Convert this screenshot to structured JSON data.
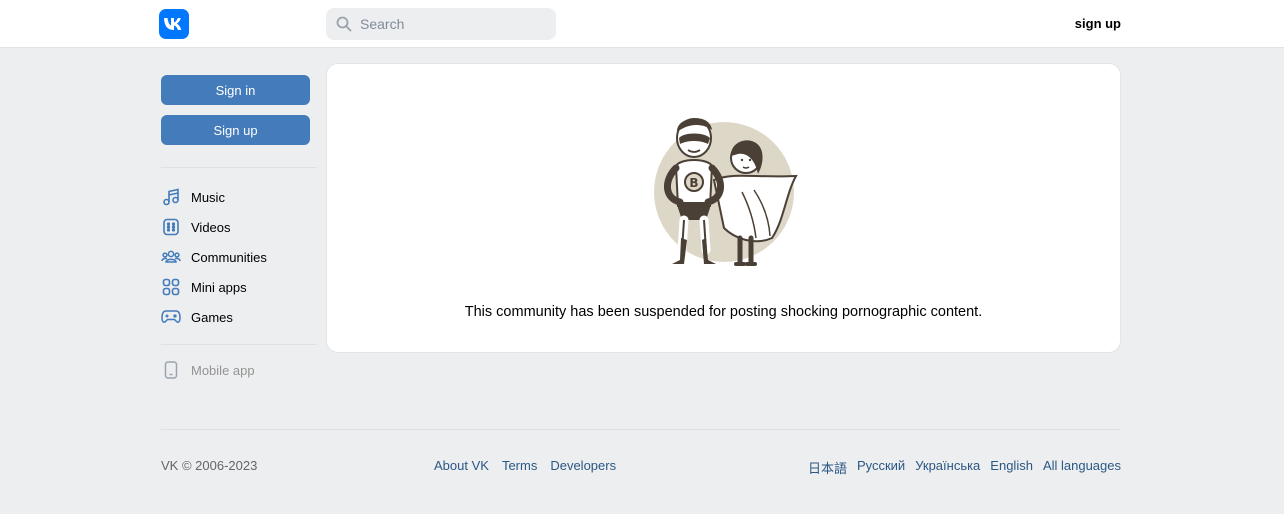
{
  "header": {
    "search_placeholder": "Search",
    "signup_link": "sign up"
  },
  "sidebar": {
    "signin_button": "Sign in",
    "signup_button": "Sign up",
    "items": [
      {
        "label": "Music",
        "icon": "music-icon"
      },
      {
        "label": "Videos",
        "icon": "videos-icon"
      },
      {
        "label": "Communities",
        "icon": "communities-icon"
      },
      {
        "label": "Mini apps",
        "icon": "mini-apps-icon"
      },
      {
        "label": "Games",
        "icon": "games-icon"
      }
    ],
    "mobile_app": "Mobile app"
  },
  "main": {
    "message": "This community has been suspended for posting shocking pornographic content."
  },
  "footer": {
    "copyright": "VK © 2006-2023",
    "links": [
      "About VK",
      "Terms",
      "Developers"
    ],
    "languages": [
      "日本語",
      "Русский",
      "Українська",
      "English",
      "All languages"
    ]
  },
  "colors": {
    "brand": "#0077ff",
    "button": "#447bba",
    "link": "#2a5885",
    "background": "#edeef0"
  }
}
